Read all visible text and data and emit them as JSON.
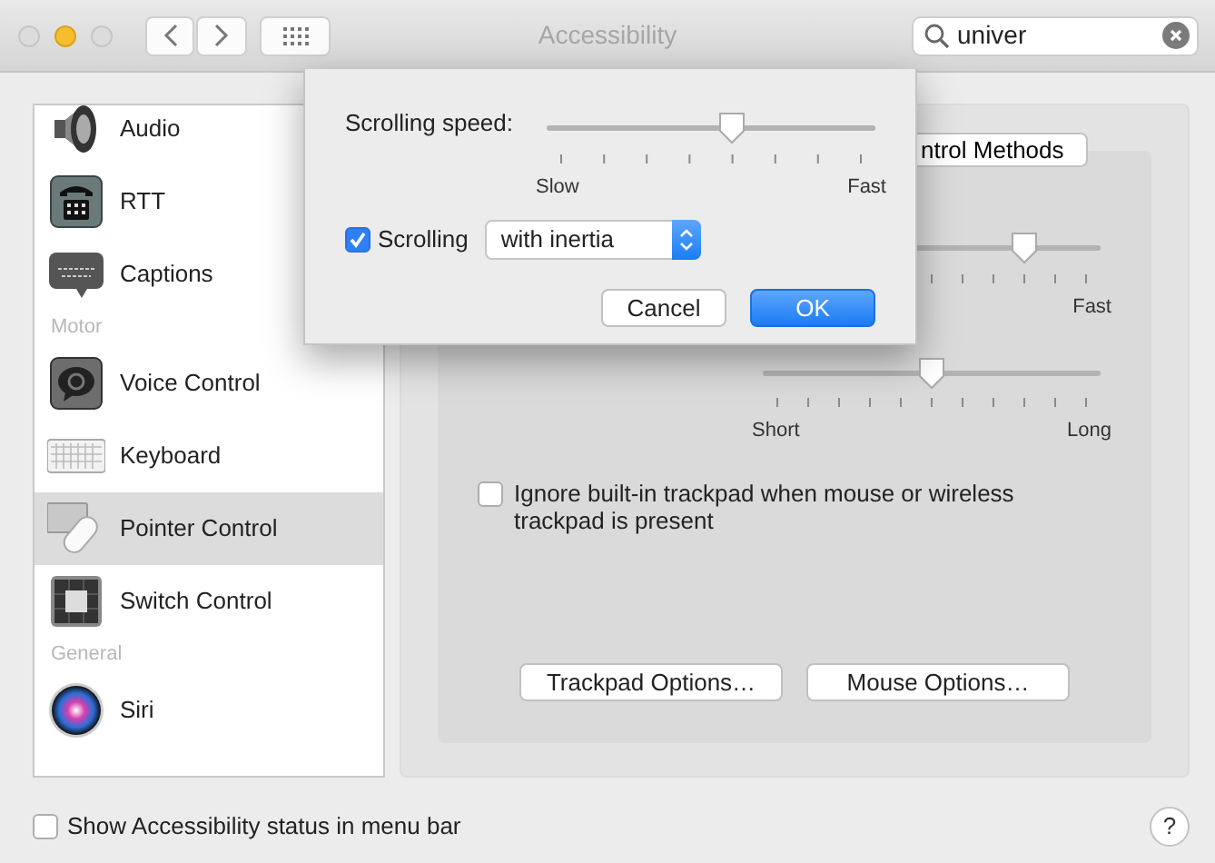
{
  "window": {
    "title": "Accessibility",
    "lights": [
      {
        "enabled": false
      },
      {
        "enabled": true
      },
      {
        "enabled": false
      }
    ]
  },
  "search": {
    "value": "univer"
  },
  "sidebar": {
    "items": [
      {
        "kind": "item",
        "label": "Audio",
        "selected": false
      },
      {
        "kind": "item",
        "label": "RTT",
        "selected": false
      },
      {
        "kind": "item",
        "label": "Captions",
        "selected": false
      },
      {
        "kind": "header",
        "label": "Motor"
      },
      {
        "kind": "item",
        "label": "Voice Control",
        "selected": false
      },
      {
        "kind": "item",
        "label": "Keyboard",
        "selected": false
      },
      {
        "kind": "item",
        "label": "Pointer Control",
        "selected": true
      },
      {
        "kind": "item",
        "label": "Switch Control",
        "selected": false
      },
      {
        "kind": "header",
        "label": "General"
      },
      {
        "kind": "item",
        "label": "Siri",
        "selected": false
      }
    ]
  },
  "panel": {
    "tab": "ntrol Methods",
    "sliders": [
      {
        "level": 0.8,
        "end_label": "Fast"
      },
      {
        "level": 0.5,
        "start_label": "Short",
        "end_label": "Long"
      }
    ],
    "checkbox": {
      "label": "Ignore built-in trackpad when mouse or wireless trackpad is present",
      "checked": false
    },
    "buttons": [
      "Trackpad Options…",
      "Mouse Options…"
    ]
  },
  "sheet": {
    "speed_label": "Scrolling speed:",
    "slider": {
      "level": 0.571,
      "start_label": "Slow",
      "end_label": "Fast"
    },
    "scrolling": {
      "label": "Scrolling",
      "checked": true
    },
    "popup": {
      "value": "with inertia"
    },
    "buttons": [
      {
        "label": "Cancel",
        "kind": "default"
      },
      {
        "label": "OK",
        "kind": "primary"
      }
    ]
  },
  "footer": {
    "checkbox": {
      "label": "Show Accessibility status in menu bar",
      "checked": false
    },
    "help": "?"
  }
}
